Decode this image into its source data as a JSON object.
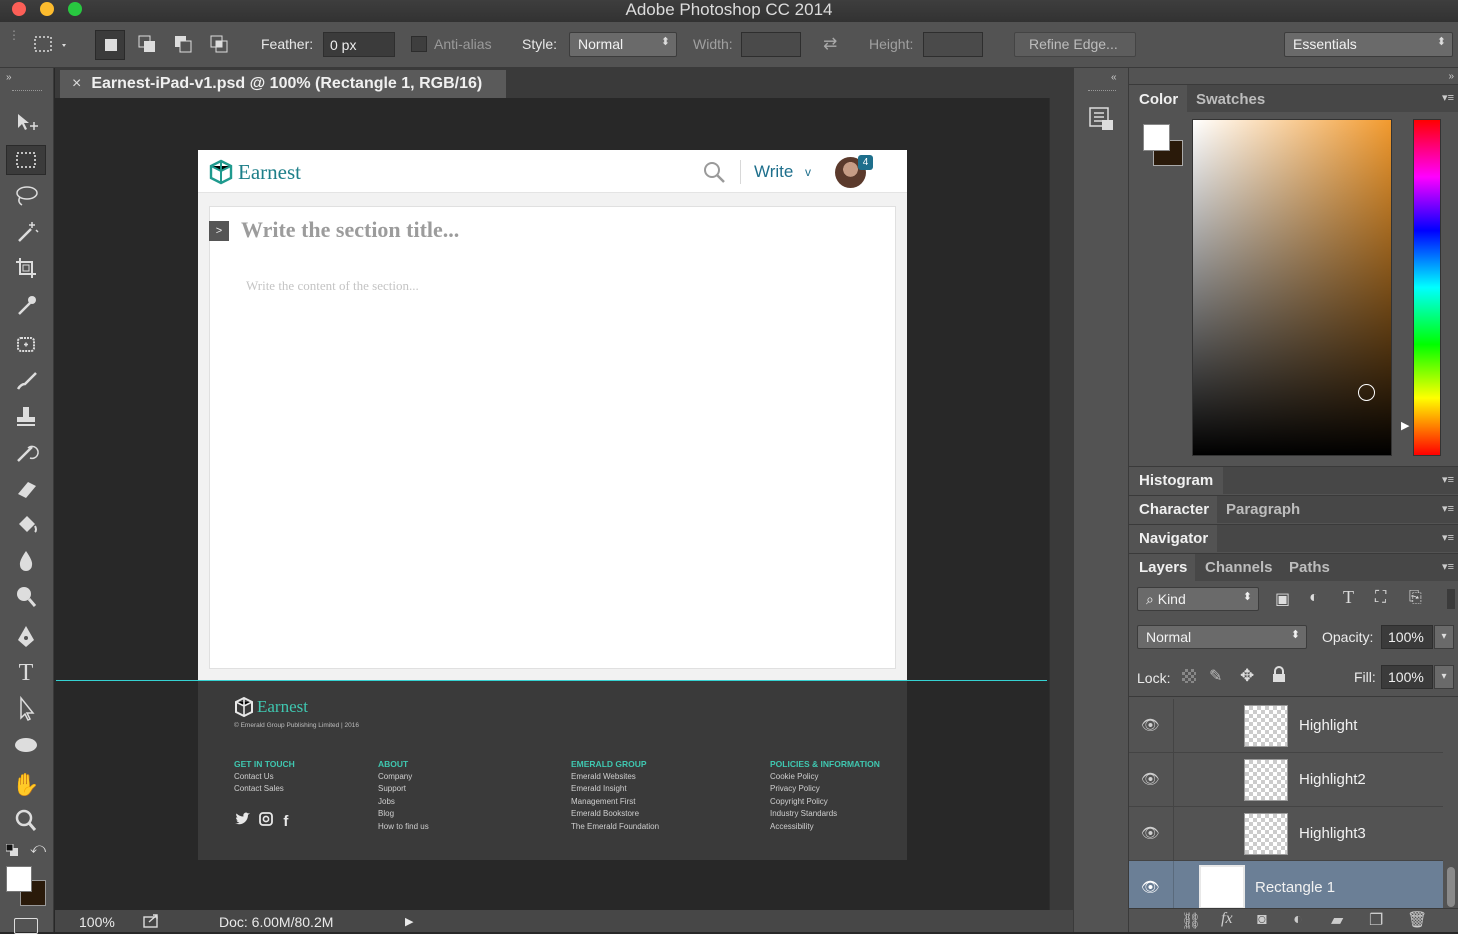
{
  "app": {
    "title": "Adobe Photoshop CC 2014"
  },
  "options": {
    "feather_label": "Feather:",
    "feather_value": "0 px",
    "antialias_label": "Anti-alias",
    "style_label": "Style:",
    "style_value": "Normal",
    "width_label": "Width:",
    "height_label": "Height:",
    "refine_edge": "Refine Edge...",
    "workspace": "Essentials"
  },
  "document": {
    "tab_title": "Earnest-iPad-v1.psd @ 100% (Rectangle 1, RGB/16)",
    "close_glyph": "×"
  },
  "mockup": {
    "brand": "Earnest",
    "write_label": "Write",
    "write_chevron": "v",
    "notification_count": "4",
    "section_toggle": ">",
    "section_title_placeholder": "Write the section title...",
    "section_content_placeholder": "Write the content of the section...",
    "footer": {
      "brand": "Earnest",
      "copyright": "© Emerald Group Publishing Limited | 2016",
      "columns": [
        {
          "heading": "GET IN TOUCH",
          "links": [
            "Contact Us",
            "Contact Sales"
          ]
        },
        {
          "heading": "ABOUT",
          "links": [
            "Company",
            "Support",
            "Jobs",
            "Blog",
            "How to find us"
          ]
        },
        {
          "heading": "EMERALD GROUP",
          "links": [
            "Emerald Websites",
            "Emerald Insight",
            "Management First",
            "Emerald Bookstore",
            "The Emerald Foundation"
          ]
        },
        {
          "heading": "POLICIES & INFORMATION",
          "links": [
            "Cookie Policy",
            "Privacy Policy",
            "Copyright Policy",
            "Industry Standards",
            "Accessibility"
          ]
        }
      ],
      "social": {
        "twitter": "🐦",
        "instagram": "◘",
        "facebook": "f"
      }
    }
  },
  "status": {
    "zoom": "100%",
    "doc_size": "Doc: 6.00M/80.2M"
  },
  "panels": {
    "color_tabs": [
      "Color",
      "Swatches"
    ],
    "histogram": "Histogram",
    "character_tabs": [
      "Character",
      "Paragraph"
    ],
    "navigator": "Navigator",
    "layers_tabs": [
      "Layers",
      "Channels",
      "Paths"
    ],
    "filter_kind": "Kind",
    "blend_mode": "Normal",
    "opacity_label": "Opacity:",
    "opacity_value": "100%",
    "lock_label": "Lock:",
    "fill_label": "Fill:",
    "fill_value": "100%",
    "layers": [
      {
        "name": "Highlight"
      },
      {
        "name": "Highlight2"
      },
      {
        "name": "Highlight3"
      },
      {
        "name": "Rectangle 1",
        "selected": true
      }
    ]
  },
  "colors": {
    "brand_teal": "#1f8f86",
    "write_blue": "#1e6f8c",
    "footer_bg": "#3a3a3a",
    "footer_heading": "#3fc7b0",
    "selected_layer": "#6b7f96",
    "guide": "#35d2d2"
  }
}
